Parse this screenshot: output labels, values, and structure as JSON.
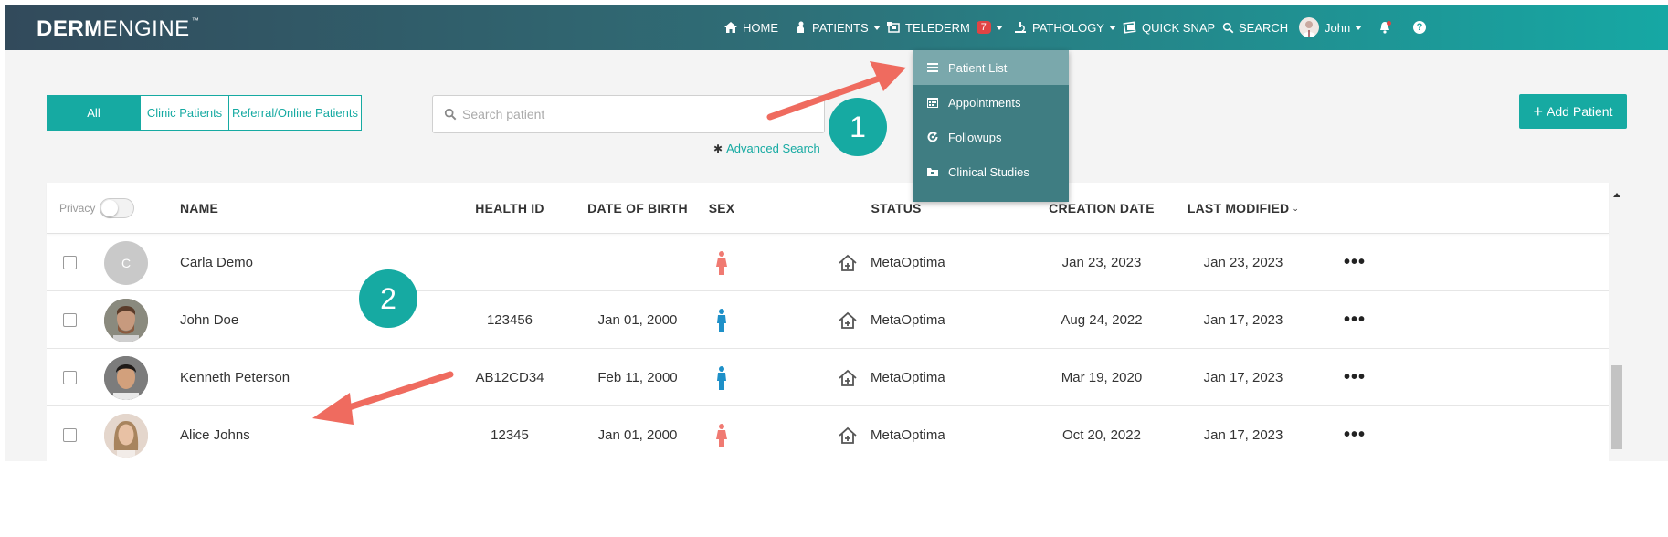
{
  "app": {
    "logo_bold": "DERM",
    "logo_light": "ENGINE",
    "logo_tm": "™"
  },
  "nav": {
    "home": "HOME",
    "patients": "PATIENTS",
    "telederm": "TELEDERM",
    "telederm_badge": "7",
    "pathology": "PATHOLOGY",
    "quick_snap": "QUICK SNAP",
    "search": "SEARCH",
    "user": "John",
    "help": "?"
  },
  "dropdown": {
    "items": [
      {
        "label": "Patient List",
        "icon": "list-icon"
      },
      {
        "label": "Appointments",
        "icon": "calendar-icon"
      },
      {
        "label": "Followups",
        "icon": "refresh-icon"
      },
      {
        "label": "Clinical Studies",
        "icon": "folder-icon"
      }
    ]
  },
  "filters": {
    "all": "All",
    "clinic": "Clinic Patients",
    "referral": "Referral/Online Patients"
  },
  "search": {
    "placeholder": "Search patient",
    "advanced": "Advanced Search"
  },
  "add_patient": "Add Patient",
  "table": {
    "privacy_label": "Privacy",
    "headers": {
      "name": "NAME",
      "health_id": "HEALTH ID",
      "dob": "DATE OF BIRTH",
      "sex": "SEX",
      "status": "STATUS",
      "creation": "CREATION DATE",
      "modified": "LAST MODIFIED"
    },
    "rows": [
      {
        "initial": "C",
        "name": "Carla Demo",
        "health_id": "",
        "dob": "",
        "sex": "female",
        "status": "MetaOptima",
        "created": "Jan 23, 2023",
        "modified": "Jan 23, 2023"
      },
      {
        "initial": "",
        "name": "John Doe",
        "health_id": "123456",
        "dob": "Jan 01, 2000",
        "sex": "male",
        "status": "MetaOptima",
        "created": "Aug 24, 2022",
        "modified": "Jan 17, 2023"
      },
      {
        "initial": "",
        "name": "Kenneth Peterson",
        "health_id": "AB12CD34",
        "dob": "Feb 11, 2000",
        "sex": "male",
        "status": "MetaOptima",
        "created": "Mar 19, 2020",
        "modified": "Jan 17, 2023"
      },
      {
        "initial": "",
        "name": "Alice Johns",
        "health_id": "12345",
        "dob": "Jan 01, 2000",
        "sex": "female",
        "status": "MetaOptima",
        "created": "Oct 20, 2022",
        "modified": "Jan 17, 2023"
      }
    ]
  },
  "callouts": {
    "one": "1",
    "two": "2"
  },
  "colors": {
    "accent": "#16aaa2",
    "female": "#f07a72",
    "male": "#1e90c8",
    "arrow": "#ef6b5f"
  }
}
